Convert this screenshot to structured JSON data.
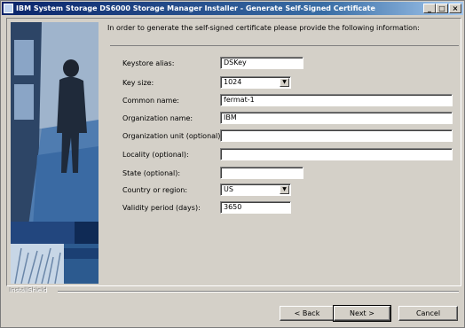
{
  "window": {
    "title": "IBM System Storage DS6000 Storage Manager Installer - Generate Self-Signed Certificate",
    "controls": [
      "_",
      "□",
      "×"
    ]
  },
  "intro_text": "In order to generate the self-signed certificate please provide the following information:",
  "form": {
    "keystore_alias": {
      "label": "Keystore alias:",
      "value": "DSKey"
    },
    "key_size": {
      "label": "Key size:",
      "value": "1024"
    },
    "common_name": {
      "label": "Common name:",
      "value": "fermat-1"
    },
    "organization_name": {
      "label": "Organization name:",
      "value": "IBM"
    },
    "organization_unit": {
      "label": "Organization unit (optional):",
      "value": ""
    },
    "locality": {
      "label": "Locality (optional):",
      "value": ""
    },
    "state": {
      "label": "State (optional):",
      "value": ""
    },
    "country": {
      "label": "Country or region:",
      "value": "US"
    },
    "validity": {
      "label": "Validity period (days):",
      "value": "3650"
    }
  },
  "footer": {
    "brand": "InstallShield",
    "back_label": "< Back",
    "next_label": "Next >",
    "cancel_label": "Cancel"
  },
  "colors": {
    "titlebar_start": "#0a246a",
    "titlebar_end": "#a6caf0",
    "face": "#d4d0c8"
  }
}
